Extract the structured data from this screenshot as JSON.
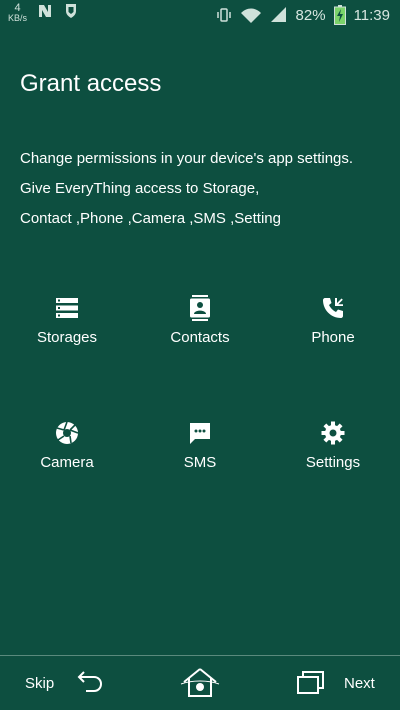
{
  "status_bar": {
    "network_speed_value": "4",
    "network_speed_unit": "KB/s",
    "battery_percent": "82%",
    "time": "11:39"
  },
  "title": "Grant access",
  "description": [
    "Change permissions in your device's app settings.",
    "Give EveryThing access to Storage,",
    "Contact ,Phone ,Camera ,SMS ,Setting"
  ],
  "permissions": [
    {
      "label": "Storages",
      "icon": "storage-icon"
    },
    {
      "label": "Contacts",
      "icon": "contacts-icon"
    },
    {
      "label": "Phone",
      "icon": "phone-icon"
    },
    {
      "label": "Camera",
      "icon": "camera-icon"
    },
    {
      "label": "SMS",
      "icon": "sms-icon"
    },
    {
      "label": "Settings",
      "icon": "settings-icon"
    }
  ],
  "bottom_bar": {
    "skip_label": "Skip",
    "next_label": "Next"
  },
  "colors": {
    "background": "#0d4f40",
    "text": "#ffffff",
    "battery_accent": "#7bd36a"
  }
}
